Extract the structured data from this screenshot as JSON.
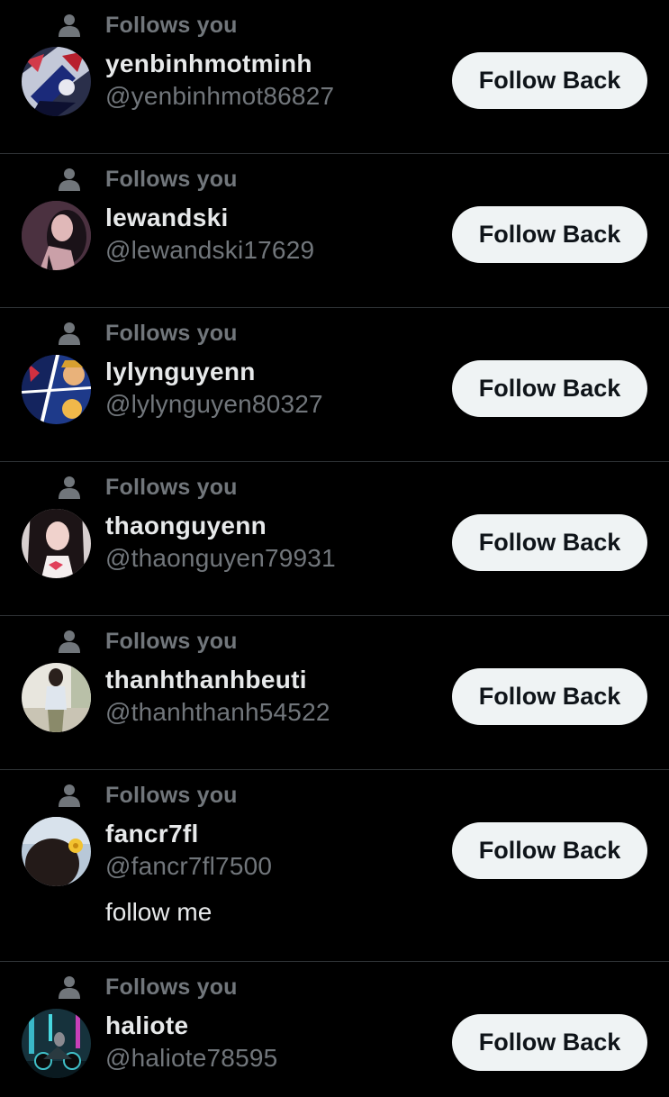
{
  "follows_label": "Follows you",
  "button_label": "Follow Back",
  "colors": {
    "background": "#000000",
    "primary_text": "#e7e9ea",
    "secondary_text": "#71767b",
    "divider": "#2f3336",
    "button_bg": "#eff3f4",
    "button_text": "#0f1419"
  },
  "followers": [
    {
      "name": "yenbinhmotminh",
      "handle": "@yenbinhmot86827",
      "bio": "",
      "avatar_icon": "anime-character-avatar"
    },
    {
      "name": "lewandski",
      "handle": "@lewandski17629",
      "bio": "",
      "avatar_icon": "girl-photo-avatar"
    },
    {
      "name": "lylynguyenn",
      "handle": "@lylynguyen80327",
      "bio": "",
      "avatar_icon": "anime-collage-avatar"
    },
    {
      "name": "thaonguyenn",
      "handle": "@thaonguyen79931",
      "bio": "",
      "avatar_icon": "girl-bow-avatar"
    },
    {
      "name": "thanhthanhbeuti",
      "handle": "@thanhthanh54522",
      "bio": "",
      "avatar_icon": "girl-standing-avatar"
    },
    {
      "name": "fancr7fl",
      "handle": "@fancr7fl7500",
      "bio": "follow me",
      "avatar_icon": "flower-hair-avatar"
    },
    {
      "name": "haliote",
      "handle": "@haliote78595",
      "bio": "",
      "avatar_icon": "cyberpunk-motorbike-avatar"
    }
  ]
}
